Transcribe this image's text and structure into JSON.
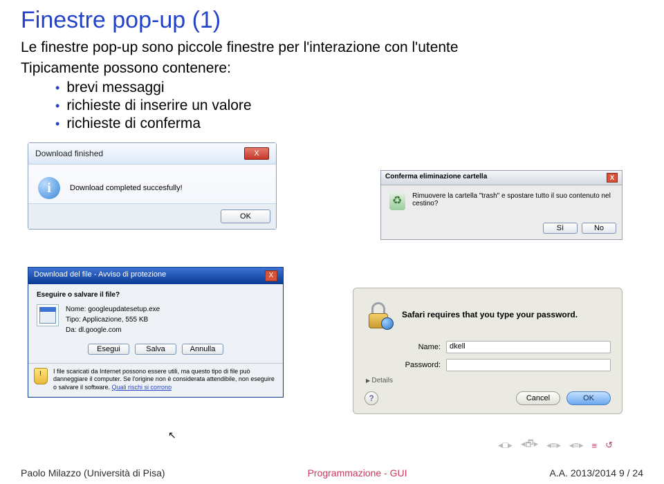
{
  "title": "Finestre pop-up (1)",
  "intro": "Le finestre pop-up sono piccole finestre per l'interazione con l'utente",
  "subintro": "Tipicamente possono contenere:",
  "bullets": [
    "brevi messaggi",
    "richieste di inserire un valore",
    "richieste di conferma"
  ],
  "dlg1": {
    "title": "Download finished",
    "message": "Download completed succesfully!",
    "ok": "OK",
    "close": "X"
  },
  "dlg2": {
    "title": "Conferma eliminazione cartella",
    "message": "Rimuovere la cartella \"trash\" e spostare tutto il suo contenuto nel cestino?",
    "yes": "Sì",
    "no": "No",
    "close": "X"
  },
  "dlg3": {
    "title": "Download del file - Avviso di protezione",
    "question": "Eseguire o salvare il file?",
    "name_label": "Nome:",
    "name_value": "googleupdatesetup.exe",
    "type_label": "Tipo:",
    "type_value": "Applicazione, 555 KB",
    "from_label": "Da:",
    "from_value": "dl.google.com",
    "run": "Esegui",
    "save": "Salva",
    "cancel": "Annulla",
    "warn": "I file scaricati da Internet possono essere utili, ma questo tipo di file può danneggiare il computer. Se l'origine non è considerata attendibile, non eseguire o salvare il software. ",
    "warn_link": "Quali rischi si corrono",
    "close": "X"
  },
  "dlg4": {
    "header": "Safari requires that you type your password.",
    "name_label": "Name:",
    "name_value": "dkell",
    "pwd_label": "Password:",
    "pwd_value": "",
    "details": "Details",
    "help": "?",
    "cancel": "Cancel",
    "ok": "OK"
  },
  "footer": {
    "author": "Paolo Milazzo (Università di Pisa)",
    "mid": "Programmazione - GUI",
    "right": "A.A. 2013/2014    9 / 24"
  }
}
